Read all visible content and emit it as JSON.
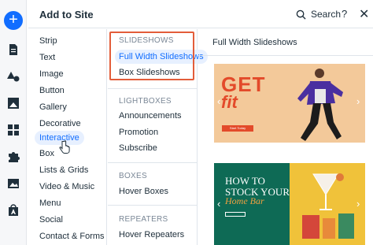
{
  "rail": {
    "add_label": "+",
    "icons": [
      "add-icon",
      "page-icon",
      "theme-icon",
      "media-icon",
      "apps-icon",
      "puzzle-icon",
      "image-icon",
      "store-icon"
    ]
  },
  "header": {
    "title": "Add to Site",
    "search_label": "Search",
    "help_label": "?",
    "close_label": "✕"
  },
  "categories": [
    "Strip",
    "Text",
    "Image",
    "Button",
    "Gallery",
    "Decorative",
    "Interactive",
    "Box",
    "Lists & Grids",
    "Video & Music",
    "Menu",
    "Social",
    "Contact & Forms"
  ],
  "selected_category": "Interactive",
  "subcategories": {
    "slideshows_title": "SLIDESHOWS",
    "slideshows": [
      "Full Width Slideshows",
      "Box Slideshows"
    ],
    "lightboxes_title": "LIGHTBOXES",
    "lightboxes": [
      "Announcements",
      "Promotion",
      "Subscribe"
    ],
    "boxes_title": "BOXES",
    "boxes": [
      "Hover Boxes"
    ],
    "repeaters_title": "REPEATERS",
    "repeaters": [
      "Hover Repeaters"
    ]
  },
  "preview": {
    "title": "Full Width Slideshows",
    "card1": {
      "headline": "GET",
      "subline": "fit",
      "cta": "Start Today"
    },
    "card2": {
      "line1": "HOW TO",
      "line2": "STOCK YOUR",
      "line3": "Home Bar"
    },
    "arrow_left": "‹",
    "arrow_right": "›"
  },
  "colors": {
    "accent": "#116dff",
    "highlight_border": "#e35d3a",
    "card1_bg": "#f3c99a",
    "card1_text": "#e34a2a",
    "card2_bg": "#0e6a55",
    "card2_yellow": "#f0c23a"
  }
}
